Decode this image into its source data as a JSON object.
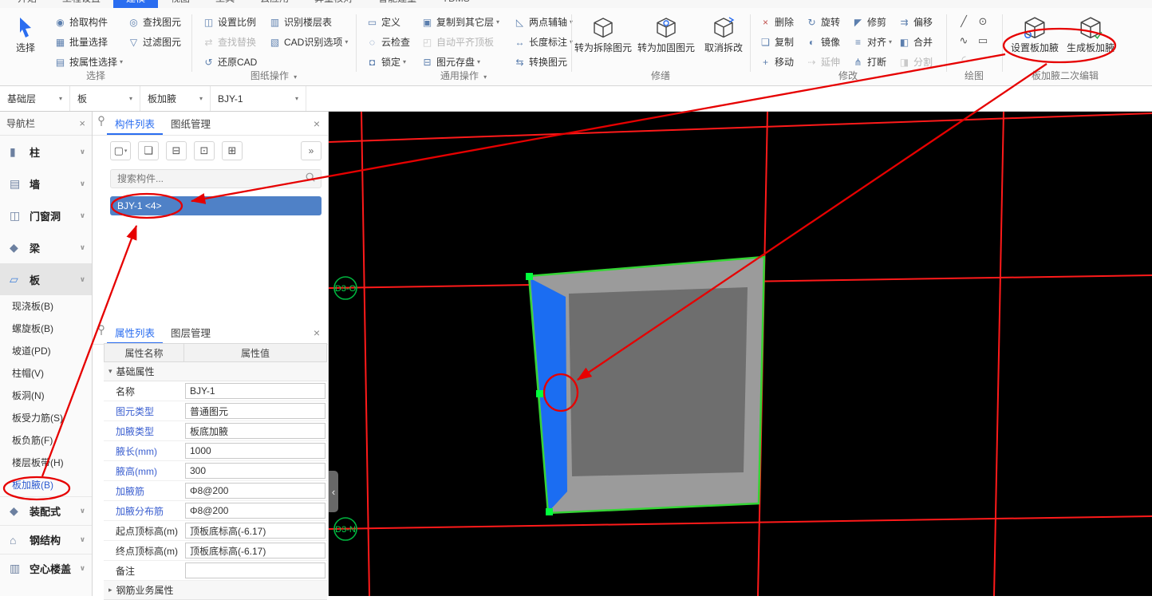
{
  "menu": {
    "tabs": [
      "开始",
      "工程设置",
      "建模",
      "视图",
      "工具",
      "云应用",
      "算量核对",
      "智能建量",
      "YDMS"
    ]
  },
  "ribbon": {
    "select_main": "选择",
    "pick_component": "拾取构件",
    "batch_select": "批量选择",
    "select_by_attribute": "按属性选择",
    "find_element": "查找图元",
    "filter_element": "过滤图元",
    "set_scale": "设置比例",
    "find_replace": "查找替换",
    "restore_cad": "还原CAD",
    "identify_floor_table": "识别楼层表",
    "cad_identify_options": "CAD识别选项",
    "define": "定义",
    "cloud_check": "云检查",
    "lock": "锁定",
    "copy_to_other_floors": "复制到其它层",
    "auto_align_top_slab": "自动平齐顶板",
    "element_save": "图元存盘",
    "two_point_aux_axis": "两点辅轴",
    "length_annotation": "长度标注",
    "convert_element": "转换图元",
    "to_demolition_element": "转为拆除图元",
    "to_reinforced_element": "转为加固图元",
    "cancel_demolition": "取消拆改",
    "delete": "删除",
    "rotate": "旋转",
    "trim": "修剪",
    "offset": "偏移",
    "copy": "复制",
    "mirror": "镜像",
    "align": "对齐",
    "merge": "合并",
    "move": "移动",
    "extend": "延伸",
    "break": "打断",
    "split": "分割",
    "set_slab_haunch": "设置板加腋",
    "generate_slab_haunch": "生成板加腋",
    "groups": {
      "select": "选择",
      "drawing_ops": "图纸操作",
      "common_ops": "通用操作",
      "renovation": "修缮",
      "modify": "修改",
      "draw": "绘图",
      "haunch_edit": "板加腋二次编辑"
    }
  },
  "layer_bar": {
    "floor": "基础层",
    "category": "板",
    "type": "板加腋",
    "component": "BJY-1"
  },
  "nav": {
    "title": "导航栏",
    "items": [
      {
        "label": "柱"
      },
      {
        "label": "墙"
      },
      {
        "label": "门窗洞"
      },
      {
        "label": "梁"
      },
      {
        "label": "板"
      }
    ],
    "sub_items": [
      "现浇板(B)",
      "螺旋板(B)",
      "坡道(PD)",
      "柱帽(V)",
      "板洞(N)",
      "板受力筋(S)",
      "板负筋(F)",
      "楼层板带(H)",
      "板加腋(B)"
    ],
    "bottom_items": [
      "装配式",
      "钢结构",
      "空心楼盖"
    ]
  },
  "component_panel": {
    "tab_components": "构件列表",
    "tab_drawings": "图纸管理",
    "search_placeholder": "搜索构件...",
    "selected_component": "BJY-1 <4>"
  },
  "properties_panel": {
    "tab_properties": "属性列表",
    "tab_layers": "图层管理",
    "col_name": "属性名称",
    "col_value": "属性值",
    "section_basic": "基础属性",
    "rows": [
      {
        "name": "名称",
        "value": "BJY-1"
      },
      {
        "name": "图元类型",
        "value": "普通图元"
      },
      {
        "name": "加腋类型",
        "value": "板底加腋"
      },
      {
        "name": "腋长(mm)",
        "value": "1000"
      },
      {
        "name": "腋高(mm)",
        "value": "300"
      },
      {
        "name": "加腋筋",
        "value": "Φ8@200"
      },
      {
        "name": "加腋分布筋",
        "value": "Φ8@200"
      },
      {
        "name": "起点顶标高(m)",
        "value": "顶板底标高(-6.17)"
      },
      {
        "name": "终点顶标高(m)",
        "value": "顶板底标高(-6.17)"
      },
      {
        "name": "备注",
        "value": ""
      }
    ],
    "section_rebar": "钢筋业务属性"
  },
  "canvas": {
    "axis_labels": [
      "D3-O",
      "D3-N"
    ]
  },
  "icons": {
    "pick_component": "◉",
    "batch_select": "▦",
    "select_by_attribute": "▤",
    "find_element": "◎",
    "filter_element": "▽",
    "set_scale": "◫",
    "find_replace": "⇄",
    "restore_cad": "↺",
    "identify_floor_table": "▥",
    "cad_identify_options": "▧",
    "define": "▭",
    "cloud_check": "◌",
    "lock": "◘",
    "copy_to_other_floors": "▣",
    "auto_align_top_slab": "◰",
    "element_save": "⊟",
    "two_point_aux_axis": "◺",
    "length_annotation": "↔",
    "convert_element": "⇆",
    "delete": "×",
    "rotate": "↻",
    "trim": "◤",
    "offset": "⇉",
    "copy": "❏",
    "mirror": "◐",
    "align": "≡",
    "merge": "◧",
    "move": "+",
    "extend": "⇢",
    "break": "⋔",
    "split": "◨",
    "draw_line": "╱",
    "draw_circle": "⊙",
    "draw_curve": "∿",
    "draw_rect": "▭",
    "draw_arc": "◜",
    "caret": "▾",
    "chevron": "∨",
    "close": "×",
    "more": "»",
    "new_component": "▢",
    "copy_component": "❏",
    "delete_component": "⊟",
    "interlayer_copy": "⊡",
    "save_archive": "⊞",
    "nav_column": "▮",
    "nav_wall": "▤",
    "nav_opening": "◫",
    "nav_beam": "◆",
    "nav_slab": "▱",
    "nav_assembly": "◆",
    "nav_steel": "⌂",
    "nav_hollow": "▥",
    "collapse_left": "‹",
    "section_open": "▾",
    "section_closed": "▸"
  },
  "colors": {
    "accent": "#2a6df0",
    "selection_bg": "#4f81c7",
    "link_text": "#3b5fd0",
    "annotation_red": "#e60000",
    "grid_red": "#ff1a1a",
    "slab_outline_green": "#35d435",
    "haunch_blue": "#1b6df2",
    "axis_green": "#00c24a"
  }
}
